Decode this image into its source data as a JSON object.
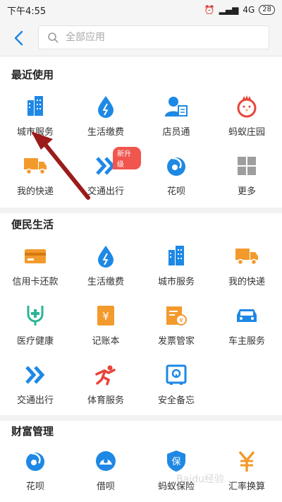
{
  "status": {
    "time": "下午4:55",
    "network": "4G",
    "battery": "28"
  },
  "search": {
    "placeholder": "全部应用"
  },
  "sections": [
    {
      "title": "最近使用",
      "items": [
        {
          "label": "城市服务",
          "icon": "city-icon"
        },
        {
          "label": "生活缴费",
          "icon": "water-drop-icon"
        },
        {
          "label": "店员通",
          "icon": "clerk-icon"
        },
        {
          "label": "蚂蚁庄园",
          "icon": "chick-icon"
        },
        {
          "label": "我的快递",
          "icon": "truck-icon"
        },
        {
          "label": "交通出行",
          "icon": "transit-icon",
          "badge": "新升级"
        },
        {
          "label": "花呗",
          "icon": "huabei-icon"
        },
        {
          "label": "更多",
          "icon": "more-grid-icon"
        }
      ]
    },
    {
      "title": "便民生活",
      "items": [
        {
          "label": "信用卡还款",
          "icon": "credit-card-icon"
        },
        {
          "label": "生活缴费",
          "icon": "water-drop-icon"
        },
        {
          "label": "城市服务",
          "icon": "city-icon"
        },
        {
          "label": "我的快递",
          "icon": "truck-icon"
        },
        {
          "label": "医疗健康",
          "icon": "medical-icon"
        },
        {
          "label": "记账本",
          "icon": "ledger-icon"
        },
        {
          "label": "发票管家",
          "icon": "invoice-icon"
        },
        {
          "label": "车主服务",
          "icon": "car-icon"
        },
        {
          "label": "交通出行",
          "icon": "transit-icon"
        },
        {
          "label": "体育服务",
          "icon": "sports-icon"
        },
        {
          "label": "安全备忘",
          "icon": "safe-icon"
        }
      ]
    },
    {
      "title": "财富管理",
      "items": [
        {
          "label": "花呗",
          "icon": "huabei-icon"
        },
        {
          "label": "借呗",
          "icon": "jiebei-icon"
        },
        {
          "label": "蚂蚁保险",
          "icon": "insurance-icon"
        },
        {
          "label": "汇率换算",
          "icon": "exchange-icon"
        }
      ]
    }
  ],
  "watermark": "Baidu经验",
  "colors": {
    "blue": "#1e88e5",
    "orange": "#f39a2d",
    "green": "#2bb596",
    "red": "#e8443a",
    "arrow": "#9b1b1b"
  }
}
